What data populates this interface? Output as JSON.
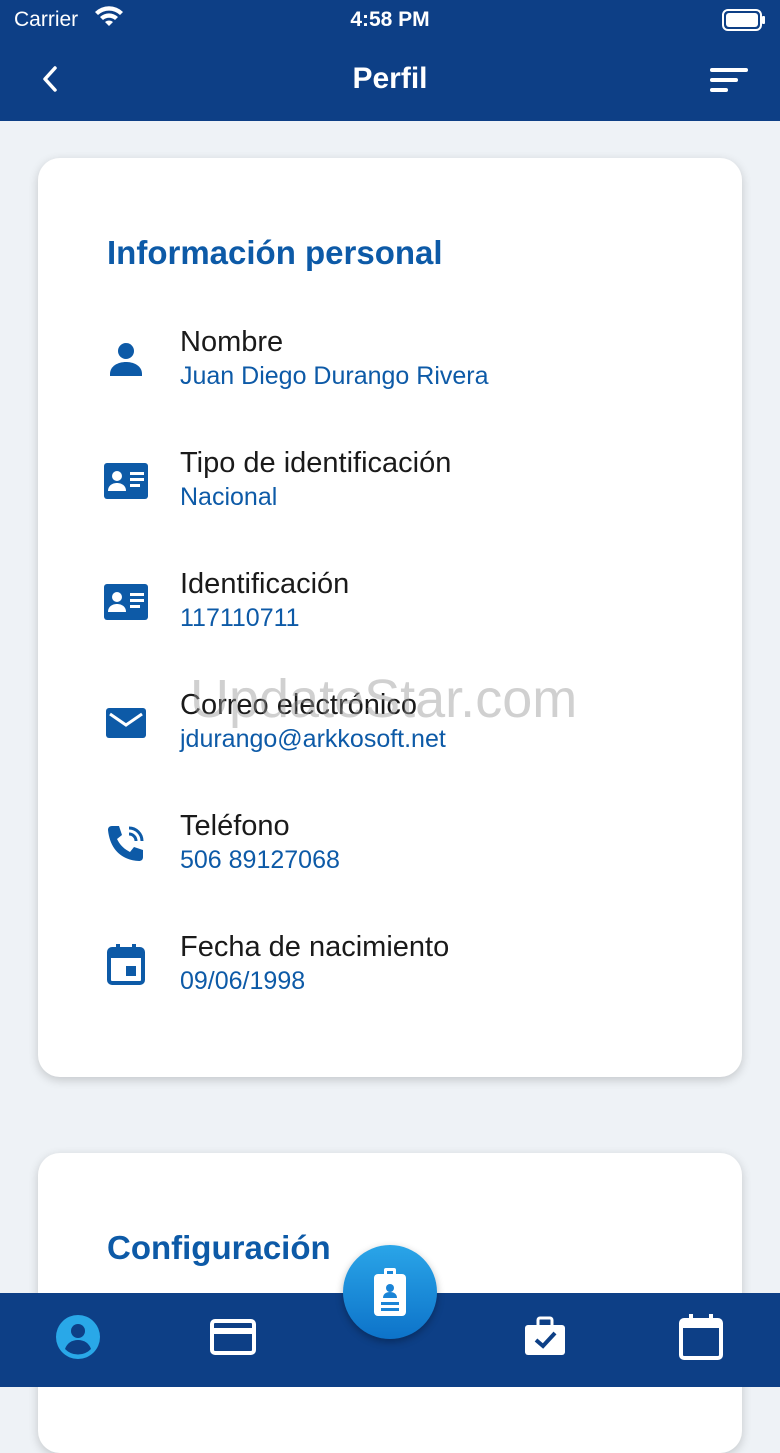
{
  "status_bar": {
    "carrier": "Carrier",
    "time": "4:58 PM"
  },
  "header": {
    "title": "Perfil"
  },
  "personal_info": {
    "title": "Información personal",
    "rows": [
      {
        "icon": "person-icon",
        "label": "Nombre",
        "value": "Juan Diego Durango Rivera"
      },
      {
        "icon": "id-card-icon",
        "label": "Tipo de identificación",
        "value": "Nacional"
      },
      {
        "icon": "id-card-icon",
        "label": "Identificación",
        "value": "117110711"
      },
      {
        "icon": "mail-icon",
        "label": "Correo electrónico",
        "value": "jdurango@arkkosoft.net"
      },
      {
        "icon": "phone-icon",
        "label": "Teléfono",
        "value": "506 89127068"
      },
      {
        "icon": "calendar-icon",
        "label": "Fecha de nacimiento",
        "value": "09/06/1998"
      }
    ]
  },
  "settings": {
    "title": "Configuración"
  },
  "watermark": "UpdateStar.com",
  "bottom_nav": {
    "items": [
      "profile-icon",
      "card-icon",
      "badge-icon",
      "briefcase-check-icon",
      "calendar-icon"
    ],
    "active": "profile-icon"
  },
  "colors": {
    "primary": "#0d3f86",
    "accent": "#0d5aa7",
    "active_tab": "#29a8e8"
  }
}
